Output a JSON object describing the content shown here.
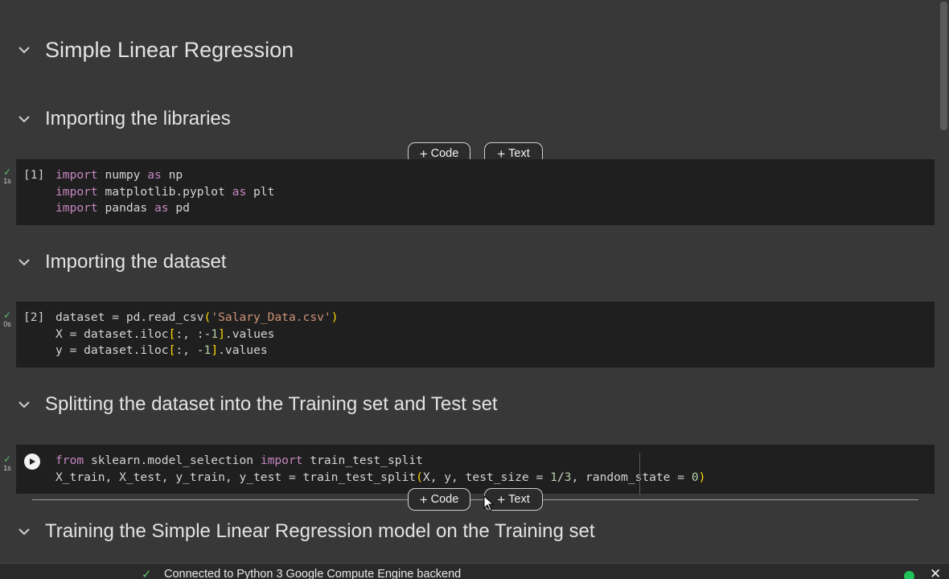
{
  "sections": {
    "main_title": "Simple Linear Regression",
    "import_libs": "Importing the libraries",
    "import_dataset": "Importing the dataset",
    "split": "Splitting the dataset into the Training set and Test set",
    "train": "Training the Simple Linear Regression model on the Training set"
  },
  "add_buttons": {
    "code_label": "Code",
    "text_label": "Text",
    "plus": "+"
  },
  "cells": [
    {
      "exec_count": "[1]",
      "status_check": "✓",
      "status_time": "1s",
      "lines": [
        {
          "kw1": "import",
          "mid": " numpy ",
          "kw2": "as",
          "end": " np"
        },
        {
          "kw1": "import",
          "mid": " matplotlib.pyplot ",
          "kw2": "as",
          "end": " plt"
        },
        {
          "kw1": "import",
          "mid": " pandas ",
          "kw2": "as",
          "end": " pd"
        }
      ]
    },
    {
      "exec_count": "[2]",
      "status_check": "✓",
      "status_time": "0s",
      "line1": {
        "a": "dataset = pd.read_csv",
        "p1": "(",
        "s": "'Salary_Data.csv'",
        "p2": ")"
      },
      "line2": {
        "a": "X = dataset.iloc",
        "b1": "[",
        "b": ":, :-",
        "n": "1",
        "b2": "]",
        "c": ".values"
      },
      "line3": {
        "a": "y = dataset.iloc",
        "b1": "[",
        "b": ":, -",
        "n": "1",
        "b2": "]",
        "c": ".values"
      }
    },
    {
      "status_check": "✓",
      "status_time": "1s",
      "line1": {
        "kw1": "from",
        "mid": " sklearn.model_selection ",
        "kw2": "import",
        "end": " train_test_split"
      },
      "line2": {
        "a": "X_train, X_test, y_train, y_test = train_test_split",
        "p1": "(",
        "b": "X, y, test_size = ",
        "n1": "1",
        "sl": "/",
        "n2": "3",
        "c": ", random_state = ",
        "n3": "0",
        "p2": ")"
      }
    }
  ],
  "statusbar": {
    "check": "✓",
    "message": "Connected to Python 3 Google Compute Engine backend",
    "close": "✕"
  }
}
